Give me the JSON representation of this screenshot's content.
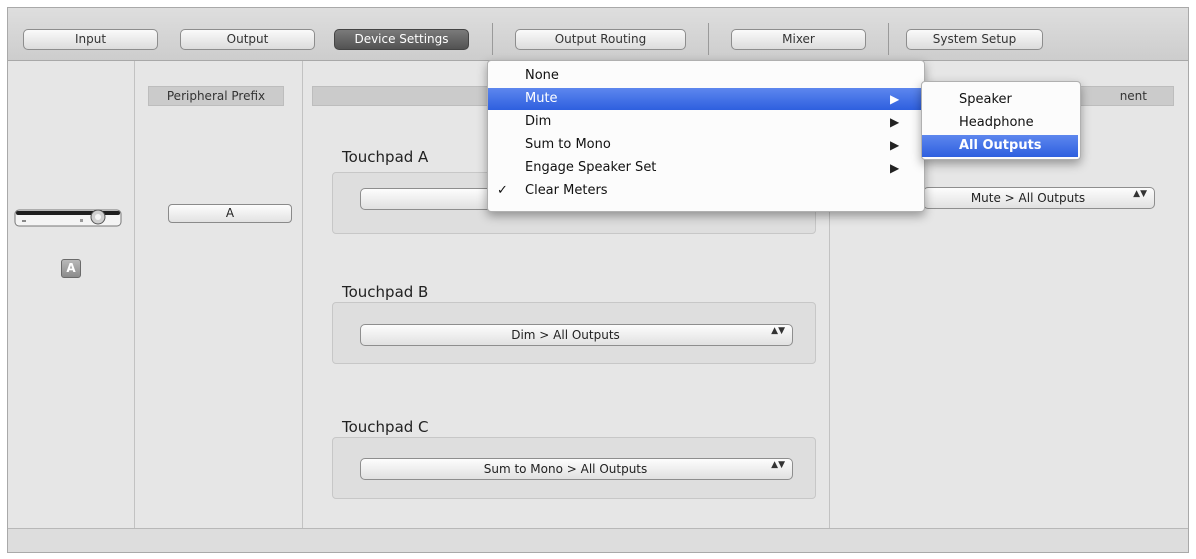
{
  "tabs": [
    {
      "label": "Input",
      "active": false
    },
    {
      "label": "Output",
      "active": false
    },
    {
      "label": "Device Settings",
      "active": true
    },
    {
      "label": "Output Routing",
      "active": false
    },
    {
      "label": "Mixer",
      "active": false
    },
    {
      "label": "System Setup",
      "active": false
    }
  ],
  "device": {
    "image_icon": "interface-device-icon",
    "badge": "A"
  },
  "peripheral": {
    "header": "Peripheral Prefix",
    "button": "A"
  },
  "touchpads": {
    "header_partial": "T",
    "a": {
      "label": "Touchpad A",
      "value": ""
    },
    "b": {
      "label": "Touchpad B",
      "value": "Dim > All Outputs"
    },
    "c": {
      "label": "Touchpad C",
      "value": "Sum to Mono > All Outputs"
    }
  },
  "right_panel": {
    "header_partial": "nent",
    "value": "Mute > All Outputs"
  },
  "menu": {
    "items": [
      {
        "label": "None",
        "checked": false,
        "submenu": false,
        "highlighted": false
      },
      {
        "label": "Mute",
        "checked": false,
        "submenu": true,
        "highlighted": true
      },
      {
        "label": "Dim",
        "checked": false,
        "submenu": true,
        "highlighted": false
      },
      {
        "label": "Sum to Mono",
        "checked": false,
        "submenu": true,
        "highlighted": false
      },
      {
        "label": "Engage Speaker Set",
        "checked": false,
        "submenu": true,
        "highlighted": false
      },
      {
        "label": "Clear Meters",
        "checked": true,
        "submenu": false,
        "highlighted": false
      }
    ],
    "check_glyph": "✓",
    "submenu_glyph": "▶"
  },
  "submenu": {
    "items": [
      {
        "label": "Speaker",
        "highlighted": false
      },
      {
        "label": "Headphone",
        "highlighted": false
      },
      {
        "label": "All Outputs",
        "highlighted": true
      }
    ]
  },
  "popup_arrows": "▲▼",
  "colors": {
    "highlight": "#3a6be3",
    "active_tab": "#5e5e5e"
  }
}
